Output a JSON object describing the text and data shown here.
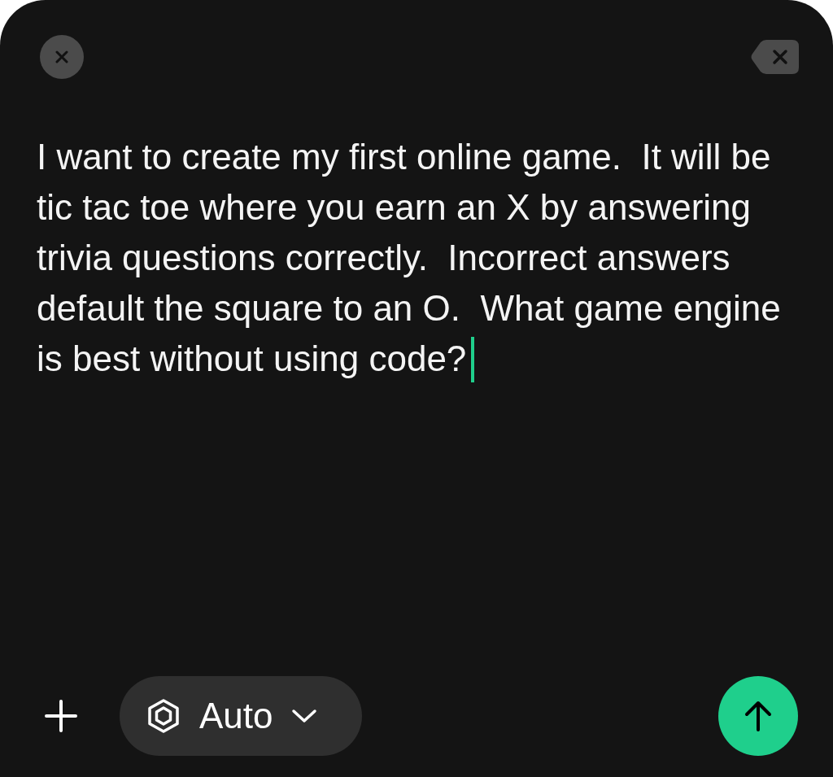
{
  "composer": {
    "value": "I want to create my first online game.  It will be tic tac toe where you earn an X by answering trivia questions correctly.  Incorrect answers default the square to an O.  What game engine is best without using code?",
    "focused": true
  },
  "model_picker": {
    "label": "Auto"
  }
}
